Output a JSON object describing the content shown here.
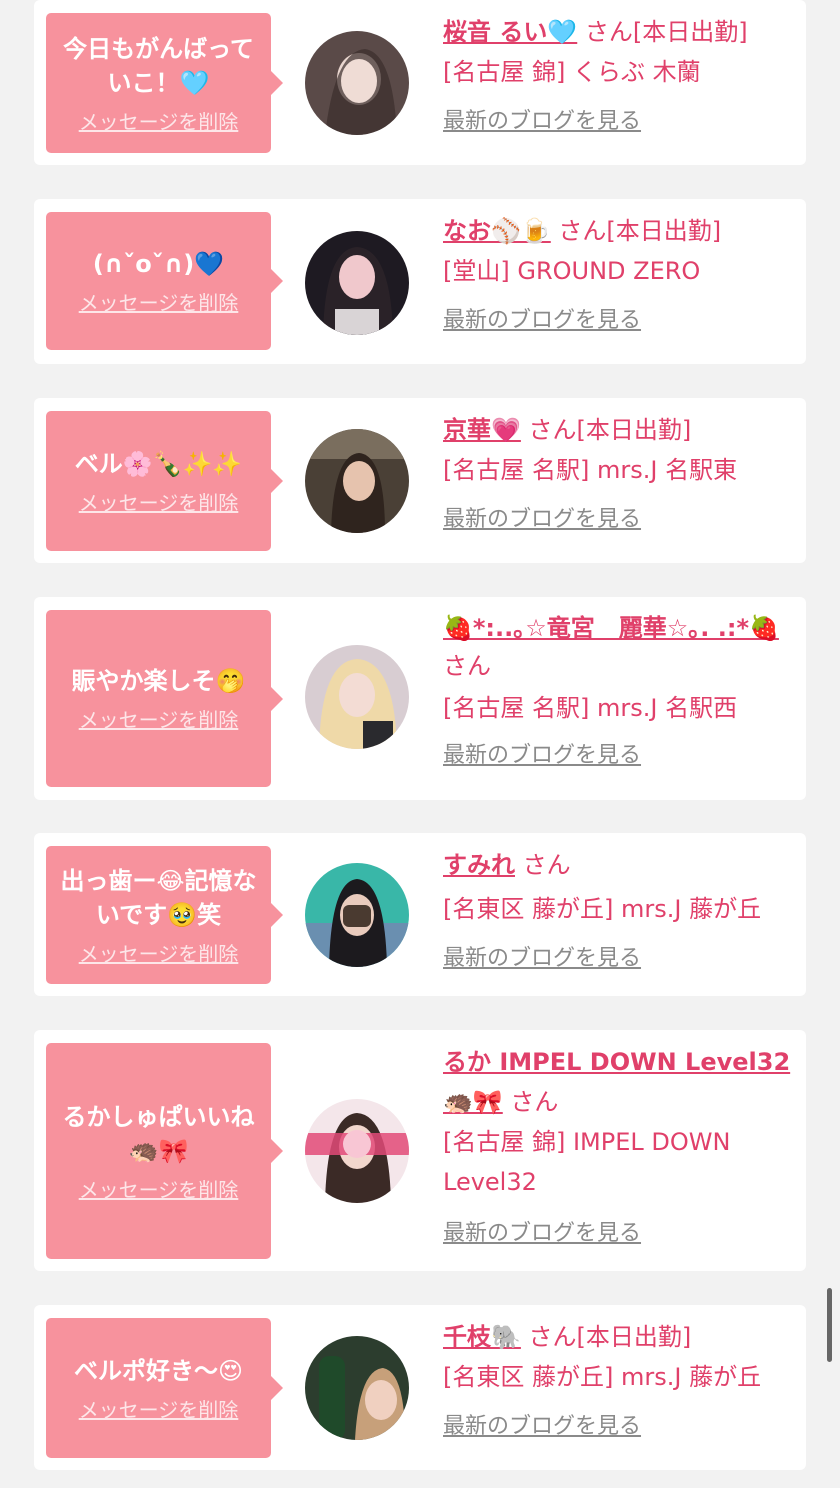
{
  "common": {
    "delete_label": "メッセージを削除",
    "blog_label": "最新のブログを見る"
  },
  "colors": {
    "bubble": "#f7929d",
    "accent": "#e0406a",
    "link_gray": "#8a8a8a",
    "background": "#f2f2f2"
  },
  "cards": [
    {
      "message": "今日もがんばっていこ！🩵",
      "name": "桜音 るい🩵",
      "suffix": "さん[本日出勤]",
      "shop": "[名古屋 錦] くらぶ 木蘭"
    },
    {
      "message": "(∩ˇoˇ∩)💙",
      "name": "なお⚾🍺",
      "suffix": "さん[本日出勤]",
      "shop": "[堂山] GROUND ZERO"
    },
    {
      "message": "ベル🌸🍾✨✨",
      "name": "京華💗",
      "suffix": "さん[本日出勤]",
      "shop": "[名古屋 名駅] mrs.J 名駅東"
    },
    {
      "message": "賑やか楽しそ🤭",
      "name": "🍓*:..｡☆竜宮　麗華☆｡. .:*🍓",
      "suffix": "さん",
      "shop": "[名古屋 名駅] mrs.J 名駅西"
    },
    {
      "message": "出っ歯ー😂記憶ないです🥹笑",
      "name": "すみれ",
      "suffix": "さん",
      "shop": "[名東区 藤が丘] mrs.J 藤が丘"
    },
    {
      "message": "るかしゅぱいいね🦔🎀",
      "name": "るか IMPEL DOWN Level32🦔🎀",
      "suffix": "さん",
      "shop": "[名古屋 錦] IMPEL DOWN Level32"
    },
    {
      "message": "ベルポ好き〜😍",
      "name": "千枝🐘",
      "suffix": "さん[本日出勤]",
      "shop": "[名東区 藤が丘] mrs.J 藤が丘"
    }
  ]
}
